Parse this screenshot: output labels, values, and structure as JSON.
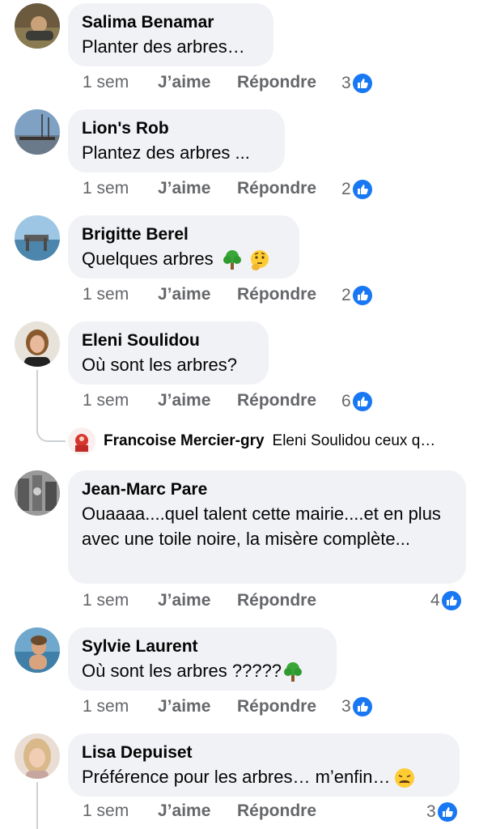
{
  "comments": [
    {
      "author": "Salima Benamar",
      "text": "Planter des arbres…",
      "time": "1 sem",
      "like_label": "J’aime",
      "reply_label": "Répondre",
      "reaction_count": "3"
    },
    {
      "author": "Lion's Rob",
      "text": "Plantez des arbres ...",
      "time": "1 sem",
      "like_label": "J’aime",
      "reply_label": "Répondre",
      "reaction_count": "2"
    },
    {
      "author": "Brigitte Berel",
      "text": "Quelques arbres",
      "time": "1 sem",
      "like_label": "J’aime",
      "reply_label": "Répondre",
      "reaction_count": "2",
      "emojis": [
        "tree-emoji",
        "thinking-emoji"
      ]
    },
    {
      "author": "Eleni Soulidou",
      "text": "Où sont les arbres?",
      "time": "1 sem",
      "like_label": "J’aime",
      "reply_label": "Répondre",
      "reaction_count": "6"
    },
    {
      "author": "Jean-Marc Pare",
      "text": "Ouaaaa....quel talent cette mairie....et en plus avec une toile noire, la misère complète...",
      "time": "1 sem",
      "like_label": "J’aime",
      "reply_label": "Répondre",
      "reaction_count": "4"
    },
    {
      "author": "Sylvie Laurent",
      "text": "Où sont les arbres ?????",
      "time": "1 sem",
      "like_label": "J’aime",
      "reply_label": "Répondre",
      "reaction_count": "3",
      "emojis": [
        "tree-emoji"
      ]
    },
    {
      "author": "Lisa Depuiset",
      "text": "Préférence pour les arbres… m’enfin…",
      "time": "1 sem",
      "like_label": "J’aime",
      "reply_label": "Répondre",
      "reaction_count": "3",
      "emojis": [
        "weary-emoji"
      ]
    }
  ],
  "reply_preview": {
    "author": "Francoise Mercier-gry",
    "text": "Eleni Soulidou ceux q…"
  },
  "colors": {
    "bubble": "#f0f2f5",
    "meta_text": "#65676b",
    "like_blue": "#1877f2"
  }
}
